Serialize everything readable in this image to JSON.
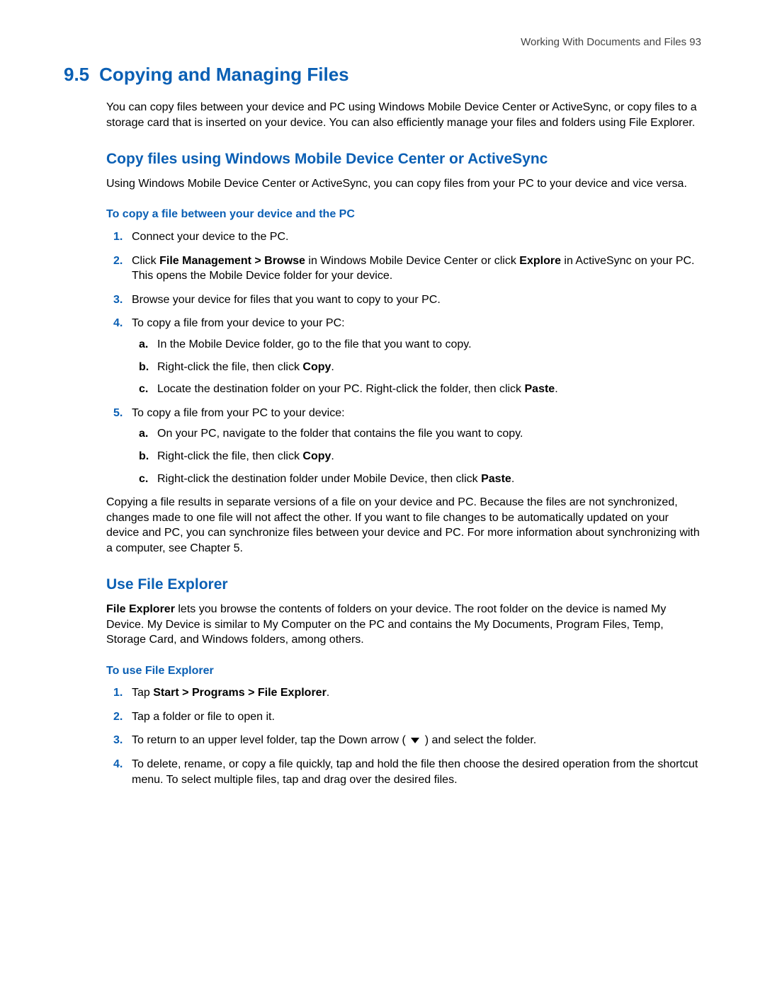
{
  "header": {
    "running": "Working With Documents and Files  93"
  },
  "section": {
    "number": "9.5",
    "title": "Copying and Managing Files"
  },
  "intro": "You can copy files between your device and PC using Windows Mobile Device Center or ActiveSync, or copy files to a storage card that is inserted on your device. You can also efficiently manage your files and folders using File Explorer.",
  "sub1": {
    "title": "Copy files using Windows Mobile Device Center or ActiveSync",
    "intro": "Using Windows Mobile Device Center or ActiveSync, you can copy files from your PC to your device and vice versa.",
    "stepTitle": "To copy a file between your device and the PC",
    "steps": {
      "s1": "Connect your device to the PC.",
      "s2_a": "Click ",
      "s2_b1": "File Management > Browse",
      "s2_c": " in Windows Mobile Device Center or click ",
      "s2_b2": "Explore",
      "s2_d": " in ActiveSync on your PC. This opens the Mobile Device folder for your device.",
      "s3": "Browse your device for files that you want to copy to your PC.",
      "s4": "To copy a file from your device to your PC:",
      "s4a": "In the Mobile Device folder, go to the file that you want to copy.",
      "s4b_a": "Right-click the file, then click ",
      "s4b_b": "Copy",
      "s4b_c": ".",
      "s4c_a": "Locate the destination folder on your PC. Right-click the folder, then click ",
      "s4c_b": "Paste",
      "s4c_c": ".",
      "s5": "To copy a file from your PC to your device:",
      "s5a": "On your PC, navigate to the folder that contains the file you want to copy.",
      "s5b_a": "Right-click the file, then click ",
      "s5b_b": "Copy",
      "s5b_c": ".",
      "s5c_a": "Right-click the destination folder under Mobile Device, then click ",
      "s5c_b": "Paste",
      "s5c_c": "."
    },
    "outro": "Copying a file results in separate versions of a file on your device and PC. Because the files are not synchronized, changes made to one file will not affect the other. If you want to file changes to be automatically updated on your device and PC, you can synchronize files between your device and PC. For more information about synchronizing with a computer, see Chapter 5."
  },
  "sub2": {
    "title": "Use File Explorer",
    "intro_b": "File Explorer",
    "intro_rest": " lets you browse the contents of folders on your device. The root folder on the device is named My Device. My Device is similar to My Computer on the PC and contains the My Documents, Program Files, Temp, Storage Card, and Windows folders, among others.",
    "stepTitle": "To use File Explorer",
    "steps": {
      "s1_a": "Tap ",
      "s1_b": "Start > Programs > File Explorer",
      "s1_c": ".",
      "s2": "Tap a folder or file to open it.",
      "s3_a": "To return to an upper level folder, tap the Down arrow ( ",
      "s3_b": " ) and select the folder.",
      "s4": "To delete, rename, or copy a file quickly, tap and hold the file then choose the desired operation from the shortcut menu. To select multiple files, tap and drag over the desired files."
    }
  }
}
